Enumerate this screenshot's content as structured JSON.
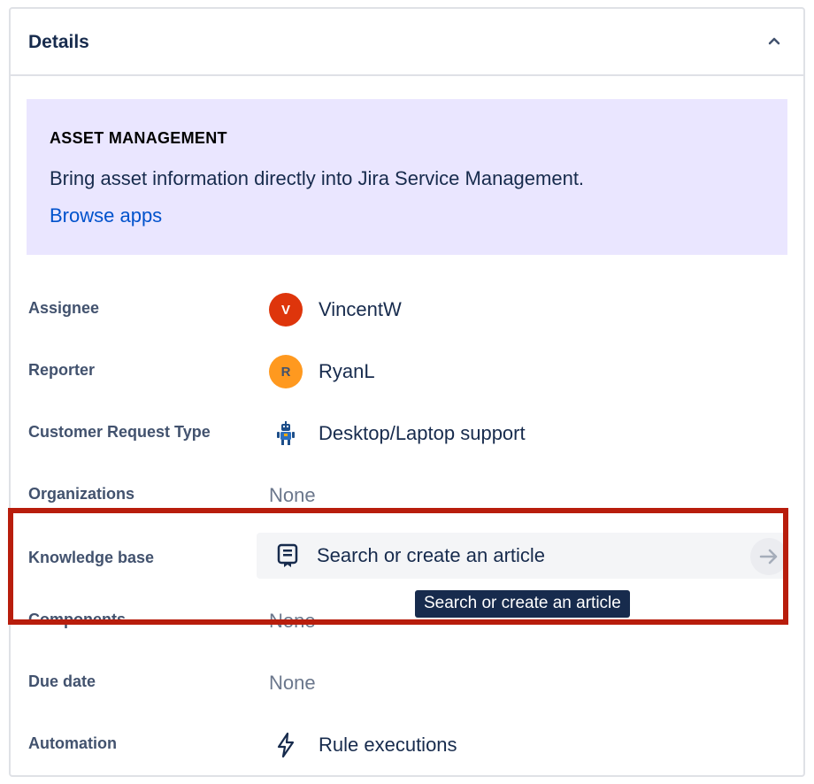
{
  "panel": {
    "title": "Details"
  },
  "banner": {
    "heading": "ASSET MANAGEMENT",
    "text": "Bring asset information directly into Jira Service Management.",
    "link": "Browse apps"
  },
  "fields": {
    "assignee": {
      "label": "Assignee",
      "value": "VincentW",
      "initial": "V",
      "avatar_color": "#DE350B"
    },
    "reporter": {
      "label": "Reporter",
      "value": "RyanL",
      "initial": "R",
      "avatar_color": "#FF991F"
    },
    "request_type": {
      "label": "Customer Request Type",
      "value": "Desktop/Laptop support",
      "icon": "robot-icon"
    },
    "organizations": {
      "label": "Organizations",
      "value": "None"
    },
    "knowledge_base": {
      "label": "Knowledge base",
      "value": "Search or create an article",
      "icon": "article-icon",
      "tooltip": "Search or create an article"
    },
    "components": {
      "label": "Components",
      "value": "None"
    },
    "due_date": {
      "label": "Due date",
      "value": "None"
    },
    "automation": {
      "label": "Automation",
      "value": "Rule executions",
      "icon": "lightning-icon"
    }
  },
  "colors": {
    "highlight": "#B81D0C",
    "banner_bg": "#EAE6FF",
    "link": "#0052CC"
  }
}
